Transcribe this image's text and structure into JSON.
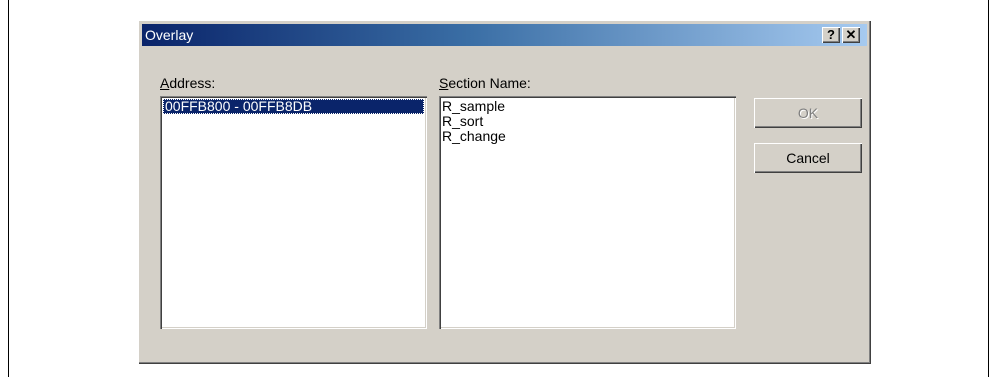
{
  "window": {
    "title": "Overlay",
    "help_glyph": "?",
    "close_glyph": "✕"
  },
  "address": {
    "label_mnemonic": "A",
    "label_rest": "ddress:",
    "items": [
      "00FFB800 - 00FFB8DB"
    ]
  },
  "section": {
    "label_mnemonic": "S",
    "label_rest": "ection Name:",
    "items": [
      "R_sample",
      "R_sort",
      "R_change"
    ]
  },
  "buttons": {
    "ok_label": "OK",
    "cancel_label": "Cancel"
  },
  "colors": {
    "titlebar_start": "#0a246a",
    "titlebar_end": "#a6caf0",
    "dialog_face": "#d4d0c8",
    "selection": "#0a246a"
  }
}
